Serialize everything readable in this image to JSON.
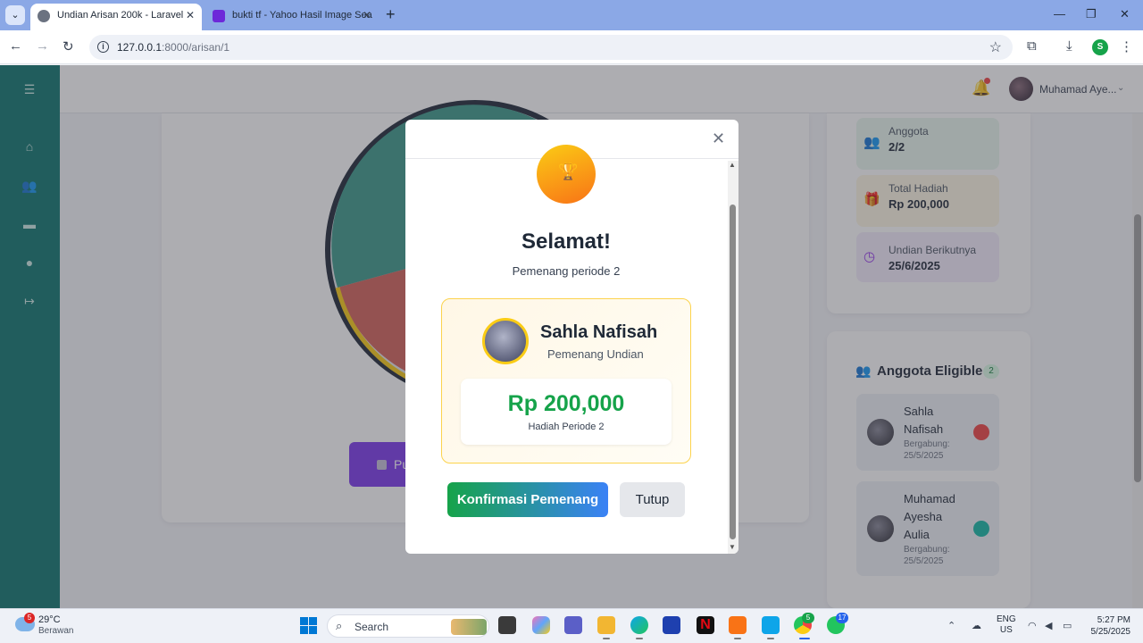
{
  "browser": {
    "tabs": [
      {
        "title": "Undian Arisan 200k - Laravel",
        "active": true
      },
      {
        "title": "bukti tf - Yahoo Hasil Image Sea",
        "active": false
      }
    ],
    "url_host": "127.0.0.1",
    "url_path": ":8000/arisan/1",
    "profile_initial": "S"
  },
  "header": {
    "user_name": "Muhamad Aye..."
  },
  "spin_button": {
    "label": "Pu"
  },
  "stats": [
    {
      "label": "Anggota",
      "value": "2/2",
      "icon": "users-icon",
      "color": "#16a34a",
      "bg": "#e8f7ee"
    },
    {
      "label": "Total Hadiah",
      "value": "Rp 200,000",
      "icon": "gift-icon",
      "color": "#ca8a04",
      "bg": "#fdf7e3"
    },
    {
      "label": "Undian Berikutnya",
      "value": "25/6/2025",
      "icon": "clock-icon",
      "color": "#9333ea",
      "bg": "#f3ecfb"
    }
  ],
  "members": {
    "title": "Anggota Eligible",
    "count": "2",
    "items": [
      {
        "name": "Sahla Nafisah",
        "joined": "Bergabung: 25/5/2025",
        "color": "#ef4444"
      },
      {
        "name": "Muhamad Ayesha Aulia",
        "joined": "Bergabung: 25/5/2025",
        "color": "#14b8a6"
      }
    ]
  },
  "modal": {
    "title": "Selamat!",
    "subtitle": "Pemenang periode 2",
    "winner_name": "Sahla Nafisah",
    "winner_role": "Pemenang Undian",
    "prize_amount": "Rp 200,000",
    "prize_label": "Hadiah Periode 2",
    "confirm_label": "Konfirmasi Pemenang",
    "close_label": "Tutup"
  },
  "taskbar": {
    "weather_badge": "5",
    "temperature": "29°C",
    "weather": "Berawan",
    "search_placeholder": "Search",
    "chrome_badge": "5",
    "whatsapp_badge": "17",
    "lang_top": "ENG",
    "lang_bottom": "US",
    "time": "5:27 PM",
    "date": "5/25/2025"
  }
}
